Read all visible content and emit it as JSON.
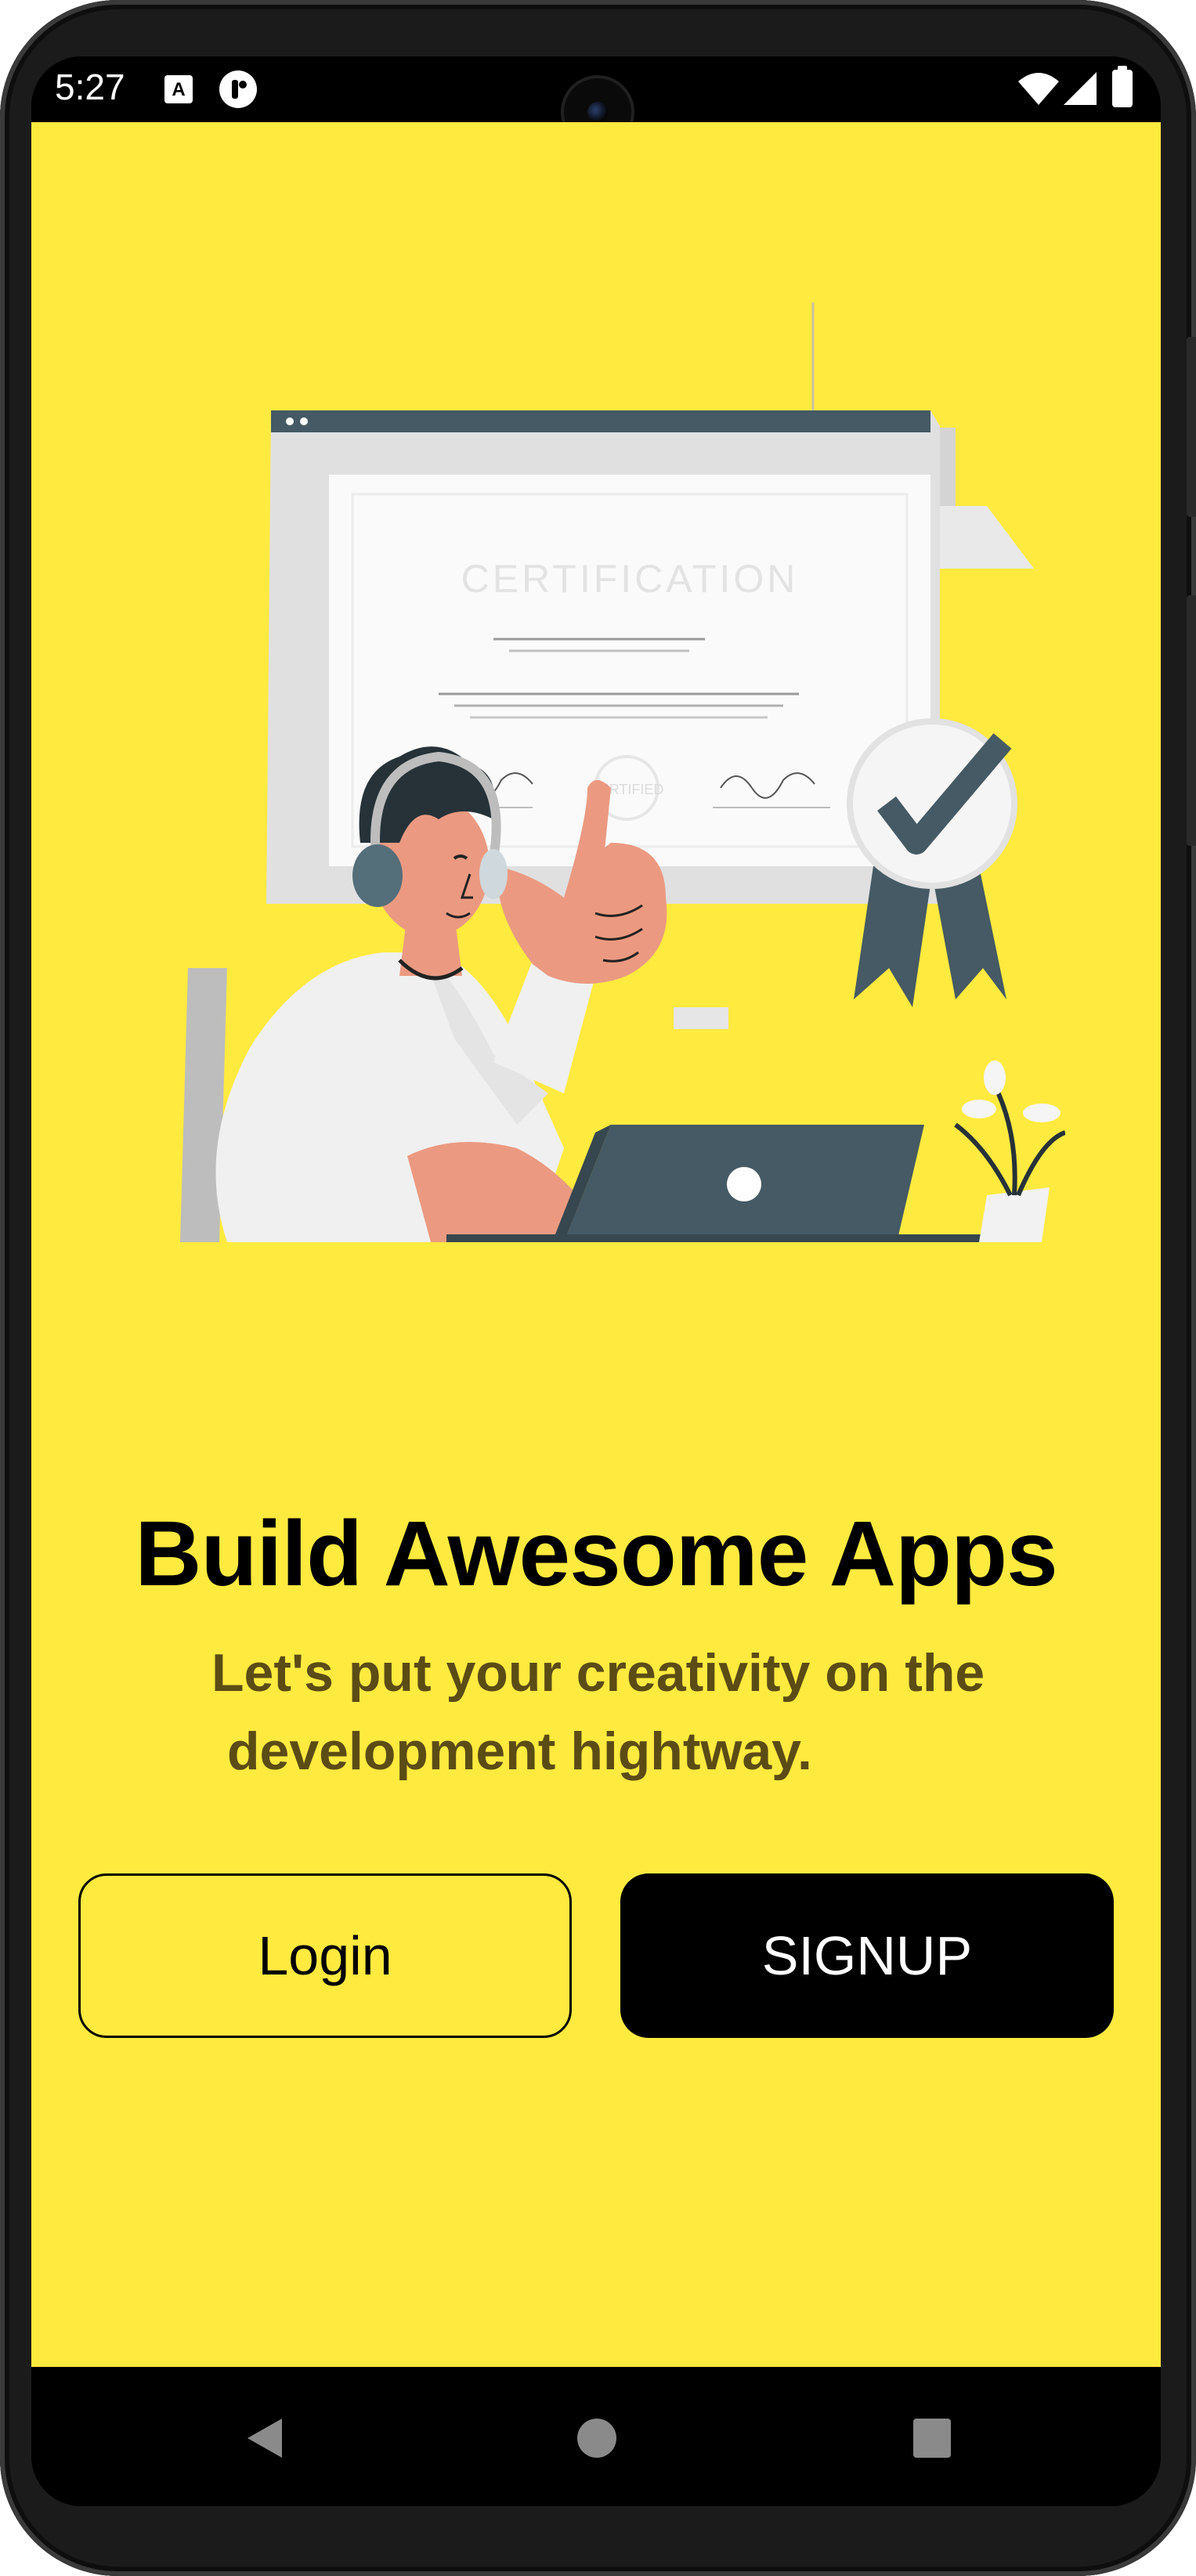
{
  "status_bar": {
    "time": "5:27",
    "icons": [
      "font-notification-icon",
      "app-notification-icon",
      "wifi-icon",
      "signal-icon",
      "battery-icon"
    ]
  },
  "illustration": {
    "certificate_heading": "CERTIFICATION",
    "badge_text": "CERTIFIED"
  },
  "content": {
    "title": "Build Awesome Apps",
    "subtitle_line1": "Let's put your creativity on the",
    "subtitle_line2": "development hightway."
  },
  "buttons": {
    "login_label": "Login",
    "signup_label": "SIGNUP"
  },
  "nav_bar": {
    "icons": [
      "back-icon",
      "home-icon",
      "recents-icon"
    ]
  },
  "colors": {
    "background": "#FFEA3F",
    "text_primary": "#000000",
    "subtitle": "#5B4C15",
    "signup_bg": "#000000",
    "illustration_dark": "#455A64",
    "skin": "#EB9A81"
  }
}
